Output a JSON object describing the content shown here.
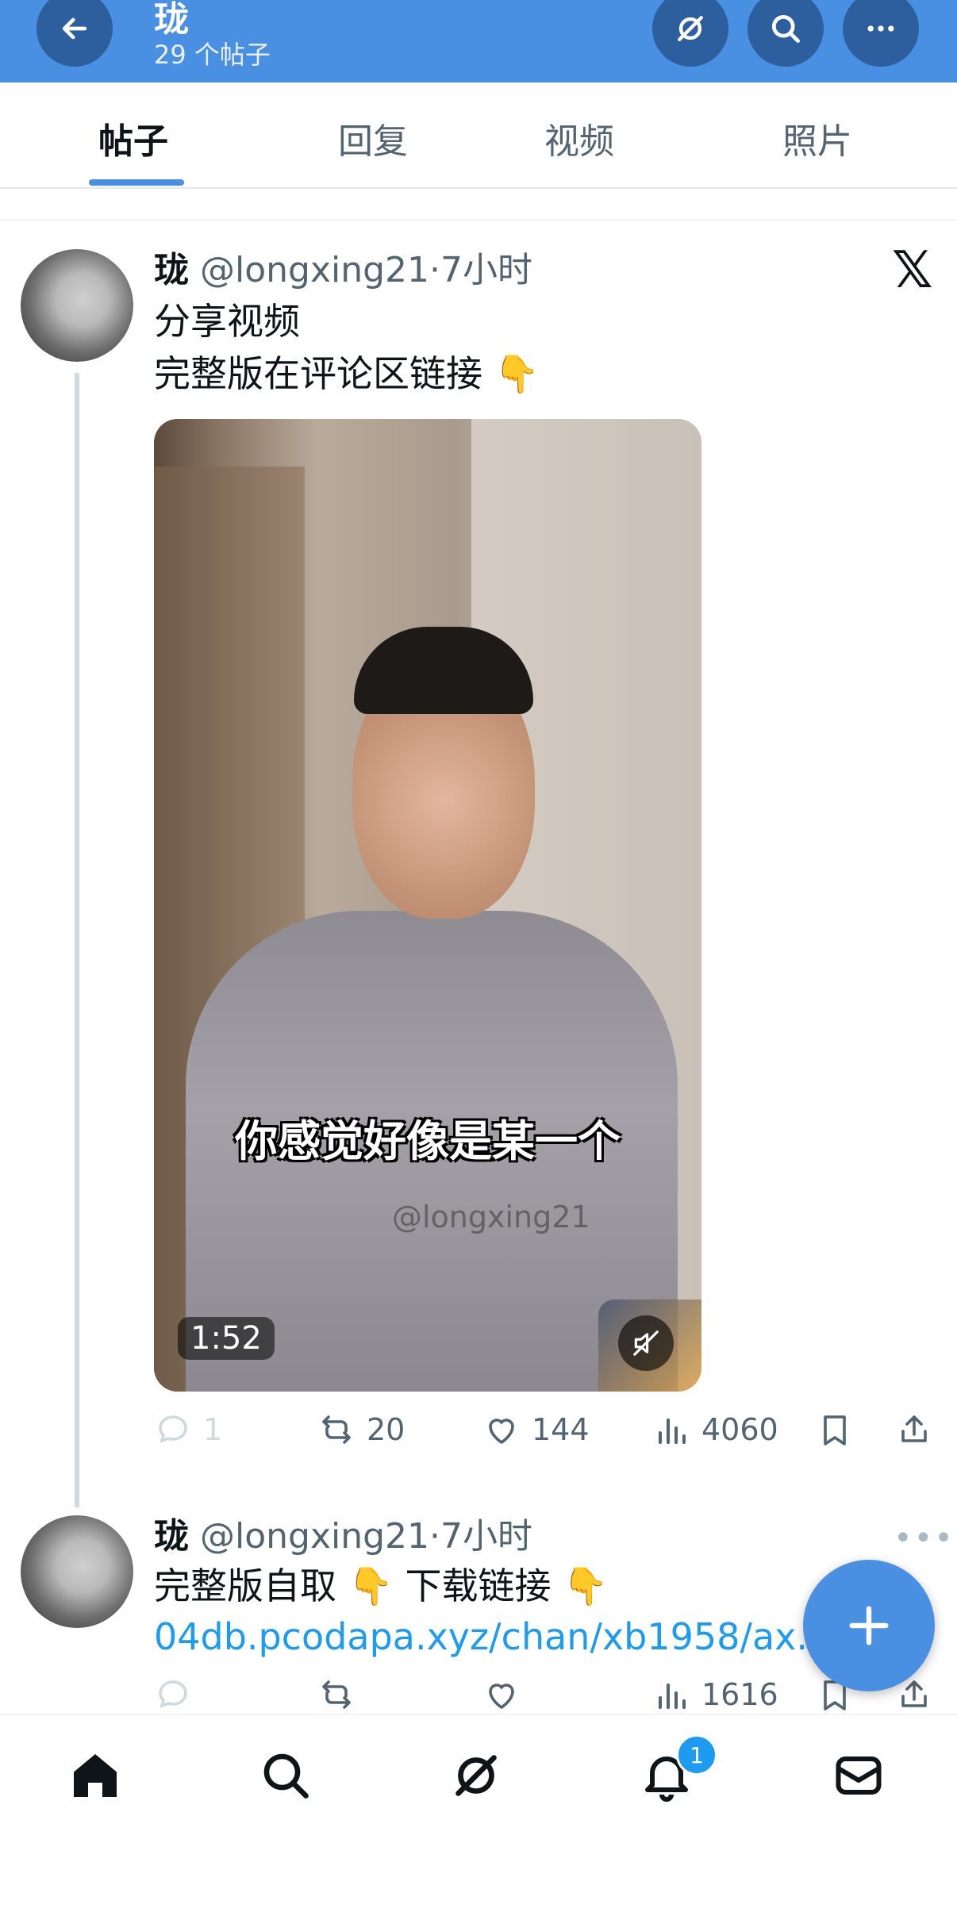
{
  "header": {
    "title": "珑",
    "subtitle": "29 个帖子",
    "back_icon": "arrow-left-icon",
    "grok_icon": "grok-icon",
    "search_icon": "search-icon",
    "more_icon": "more-icon",
    "color": "#4a90e2"
  },
  "tabs": [
    {
      "label": "帖子",
      "active": true
    },
    {
      "label": "回复",
      "active": false
    },
    {
      "label": "视频",
      "active": false
    },
    {
      "label": "照片",
      "active": false
    }
  ],
  "posts": [
    {
      "name": "珑",
      "meta": "@longxing21·7小时",
      "line1": "分享视频",
      "line2": "完整版在评论区链接 👇",
      "video": {
        "subtitle": "你感觉好像是某一个",
        "watermark": "@longxing21",
        "duration": "1:52"
      },
      "stats": {
        "replies": "1",
        "reposts": "20",
        "likes": "144",
        "views": "4060"
      }
    },
    {
      "name": "珑",
      "meta": "@longxing21·7小时",
      "line1": "完整版自取 👇 下载链接 👇",
      "link": "04db.pcodapa.xyz/chan/xb1958/ax...",
      "stats": {
        "views": "1616"
      }
    }
  ],
  "x_logo": "𝕏",
  "more_dots": "•••",
  "nav": {
    "items": [
      "home-icon",
      "search-icon",
      "grok-icon",
      "notifications-icon",
      "messages-icon"
    ],
    "notification_badge": "1"
  }
}
